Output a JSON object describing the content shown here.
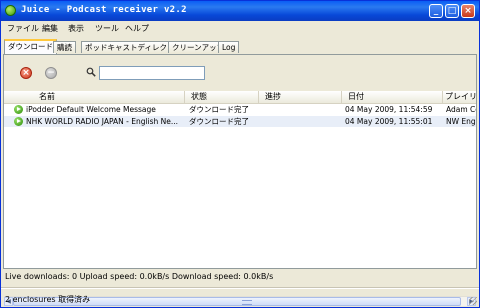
{
  "window": {
    "title": "Juice - Podcast receiver v2.2"
  },
  "titlebar_buttons": {
    "minimize": "_",
    "maximize": "□",
    "close": "×"
  },
  "menu": [
    "ファイル",
    "編集",
    "表示",
    "ツール",
    "ヘルプ"
  ],
  "tabs": [
    "ダウンロード",
    "購読",
    "ポッドキャストディレクトリ",
    "クリーンアップ",
    "Log"
  ],
  "toolbar": {
    "search_value": "",
    "search_placeholder": ""
  },
  "list": {
    "columns": [
      "名前",
      "状態",
      "進捗",
      "日付",
      "プレイリ"
    ],
    "rows": [
      {
        "name": "iPodder Default Welcome Message",
        "status": "ダウンロード完了",
        "progress": "",
        "date": "04 May 2009, 11:54:59",
        "playlist": "Adam Co"
      },
      {
        "name": "NHK WORLD RADIO JAPAN - English Ne...",
        "status": "ダウンロード完了",
        "progress": "",
        "date": "04 May 2009, 11:55:01",
        "playlist": "NW Engl"
      }
    ]
  },
  "status": {
    "line1": "Live downloads: 0 Upload speed: 0.0kB/s Download speed: 0.0kB/s",
    "line2": "2 enclosures 取得済み"
  },
  "colors": {
    "title_bar": "#0a5ef5",
    "close_red": "#d33a1e",
    "play_green": "#3a9a0a"
  },
  "icons": [
    "app-icon",
    "cancel-icon",
    "stop-icon",
    "search-icon",
    "play-icon"
  ]
}
